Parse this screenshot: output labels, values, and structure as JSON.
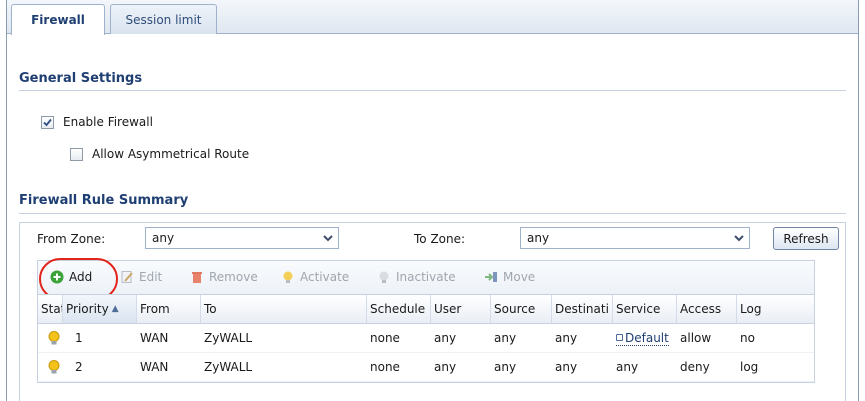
{
  "tabs": [
    {
      "label": "Firewall",
      "active": true
    },
    {
      "label": "Session limit",
      "active": false
    }
  ],
  "general_settings": {
    "title": "General Settings",
    "enable_firewall": {
      "label": "Enable Firewall",
      "checked": true
    },
    "allow_asymmetrical_route": {
      "label": "Allow Asymmetrical Route",
      "checked": false
    }
  },
  "rule_summary": {
    "title": "Firewall Rule Summary",
    "from_zone_label": "From Zone:",
    "from_zone_value": "any",
    "to_zone_label": "To Zone:",
    "to_zone_value": "any",
    "refresh_label": "Refresh"
  },
  "toolbar": {
    "add": "Add",
    "edit": "Edit",
    "remove": "Remove",
    "activate": "Activate",
    "inactivate": "Inactivate",
    "move": "Move"
  },
  "table": {
    "headers": [
      "Stat",
      "Priority",
      "From",
      "To",
      "Schedule",
      "User",
      "Source",
      "Destinati",
      "Service",
      "Access",
      "Log"
    ],
    "rows": [
      {
        "priority": "1",
        "from": "WAN",
        "to": "ZyWALL",
        "schedule": "none",
        "user": "any",
        "source": "any",
        "destination": "any",
        "service": "Default",
        "access": "allow",
        "log": "no"
      },
      {
        "priority": "2",
        "from": "WAN",
        "to": "ZyWALL",
        "schedule": "none",
        "user": "any",
        "source": "any",
        "destination": "any",
        "service": "any",
        "access": "deny",
        "log": "log"
      }
    ]
  },
  "colors": {
    "accent": "#1f3f73",
    "highlight_circle": "#e2231a",
    "status_bulb": "#f4c21a"
  }
}
